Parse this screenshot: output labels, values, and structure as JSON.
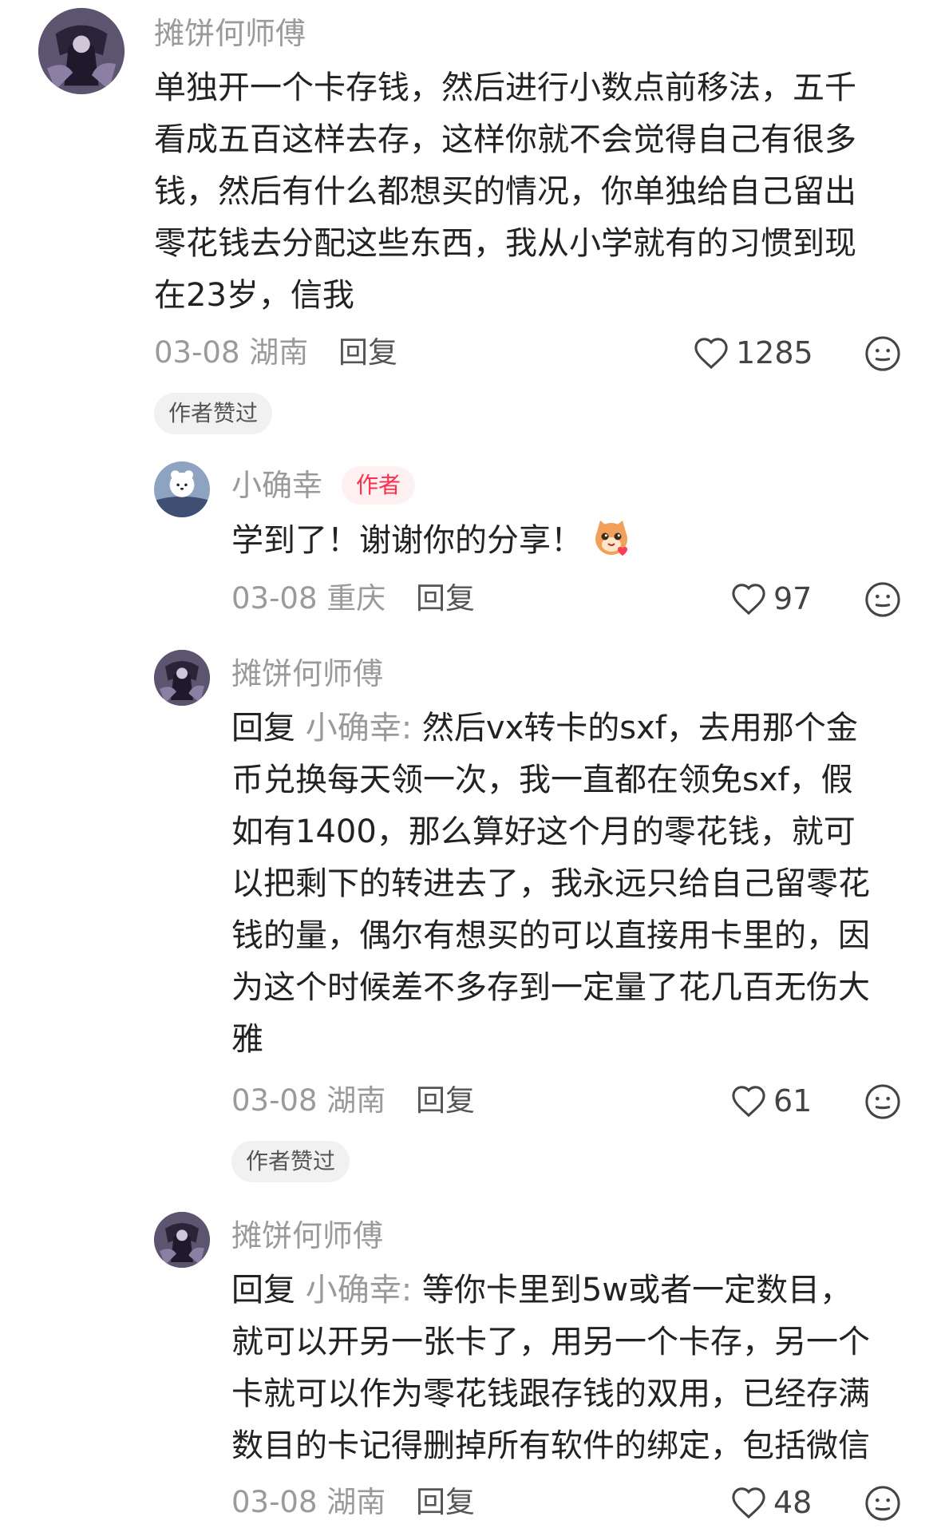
{
  "comments": [
    {
      "username": "摊饼何师傅",
      "lines": [
        "单独开一个卡存钱，然后进行小数点前移法，五千",
        "看成五百这样去存，这样你就不会觉得自己有很多",
        "钱，然后有什么都想买的情况，你单独给自己留出",
        "零花钱去分配这些东西，我从小学就有的习惯到现",
        "在23岁，信我"
      ],
      "date": "03-08",
      "location": "湖南",
      "reply_label": "回复",
      "likes": "1285",
      "badge": "作者赞过"
    },
    {
      "username": "小确幸",
      "tag": "作者",
      "text": "学到了！谢谢你的分享！",
      "sticker": "cat-sticker",
      "date": "03-08",
      "location": "重庆",
      "reply_label": "回复",
      "likes": "97"
    },
    {
      "username": "摊饼何师傅",
      "reply_prefix": "回复",
      "reply_target": "小确幸:",
      "first_line_rest": " 然后vx转卡的sxf，去用那个金",
      "lines": [
        "币兑换每天领一次，我一直都在领免sxf，假",
        "如有1400，那么算好这个月的零花钱，就可",
        "以把剩下的转进去了，我永远只给自己留零花",
        "钱的量，偶尔有想买的可以直接用卡里的，因",
        "为这个时候差不多存到一定量了花几百无伤大",
        "雅"
      ],
      "date": "03-08",
      "location": "湖南",
      "reply_label": "回复",
      "likes": "61",
      "badge": "作者赞过"
    },
    {
      "username": "摊饼何师傅",
      "reply_prefix": "回复",
      "reply_target": "小确幸:",
      "first_line_rest": " 等你卡里到5w或者一定数目，",
      "lines": [
        "就可以开另一张卡了，用另一个卡存，另一个",
        "卡就可以作为零花钱跟存钱的双用，已经存满",
        "数目的卡记得删掉所有软件的绑定，包括微信"
      ],
      "date": "03-08",
      "location": "湖南",
      "reply_label": "回复",
      "likes": "48"
    }
  ],
  "icons": {
    "like": "heart-outline-icon",
    "emoji": "smiley-face-icon"
  },
  "colors": {
    "author_tag_text": "#ff2e4d",
    "author_tag_bg": "#fff0f2",
    "meta_gray": "#9a9a9a"
  }
}
